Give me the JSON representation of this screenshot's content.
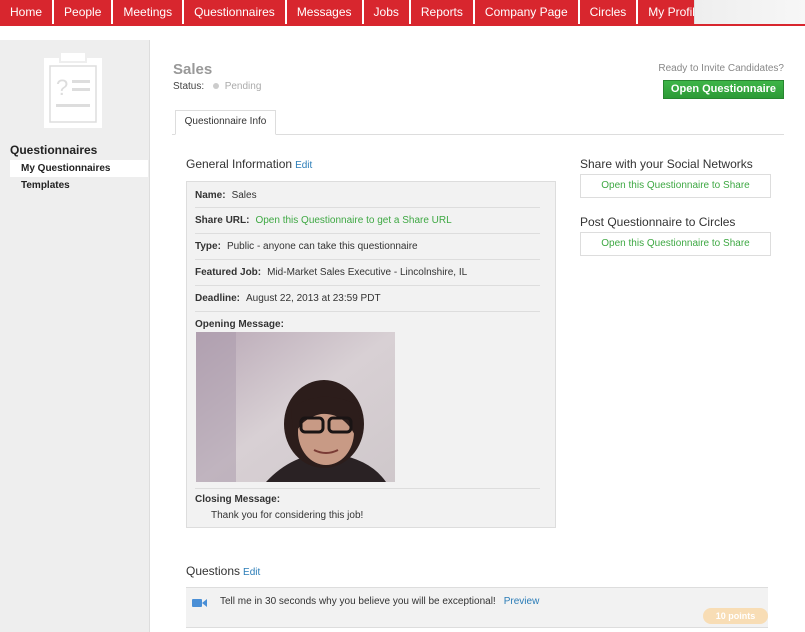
{
  "nav": {
    "tabs": [
      "Home",
      "People",
      "Meetings",
      "Questionnaires",
      "Messages",
      "Jobs",
      "Reports",
      "Company Page",
      "Circles",
      "My Profile"
    ]
  },
  "sidebar": {
    "title": "Questionnaires",
    "items": [
      {
        "label": "My Questionnaires",
        "active": true
      },
      {
        "label": "Templates",
        "active": false
      }
    ]
  },
  "header": {
    "title": "Sales",
    "status_label": "Status:",
    "status_value": "Pending",
    "ready_text": "Ready to Invite Candidates?",
    "open_button": "Open Questionnaire"
  },
  "tabs": {
    "info": "Questionnaire Info"
  },
  "general": {
    "heading": "General Information",
    "edit": "Edit",
    "name_label": "Name:",
    "name_value": "Sales",
    "share_label": "Share URL:",
    "share_value": "Open this Questionnaire to get a Share URL",
    "type_label": "Type:",
    "type_value": "Public - anyone can take this questionnaire",
    "job_label": "Featured Job:",
    "job_value": "Mid-Market Sales Executive - Lincolnshire, IL",
    "deadline_label": "Deadline:",
    "deadline_value": "August 22, 2013 at 23:59 PDT",
    "opening_label": "Opening Message:",
    "closing_label": "Closing Message:",
    "closing_value": "Thank you for considering this job!"
  },
  "share": {
    "social_heading": "Share with your Social Networks",
    "social_button": "Open this Questionnaire to Share",
    "circles_heading": "Post Questionnaire to Circles",
    "circles_button": "Open this Questionnaire to Share"
  },
  "questions": {
    "heading": "Questions",
    "edit": "Edit",
    "items": [
      {
        "text": "Tell me in 30 seconds why you believe you will be exceptional!",
        "preview": "Preview",
        "points": "10 points"
      }
    ]
  },
  "colors": {
    "brand_red": "#d8262e",
    "green": "#3eb548",
    "link_blue": "#2a7cb7"
  }
}
